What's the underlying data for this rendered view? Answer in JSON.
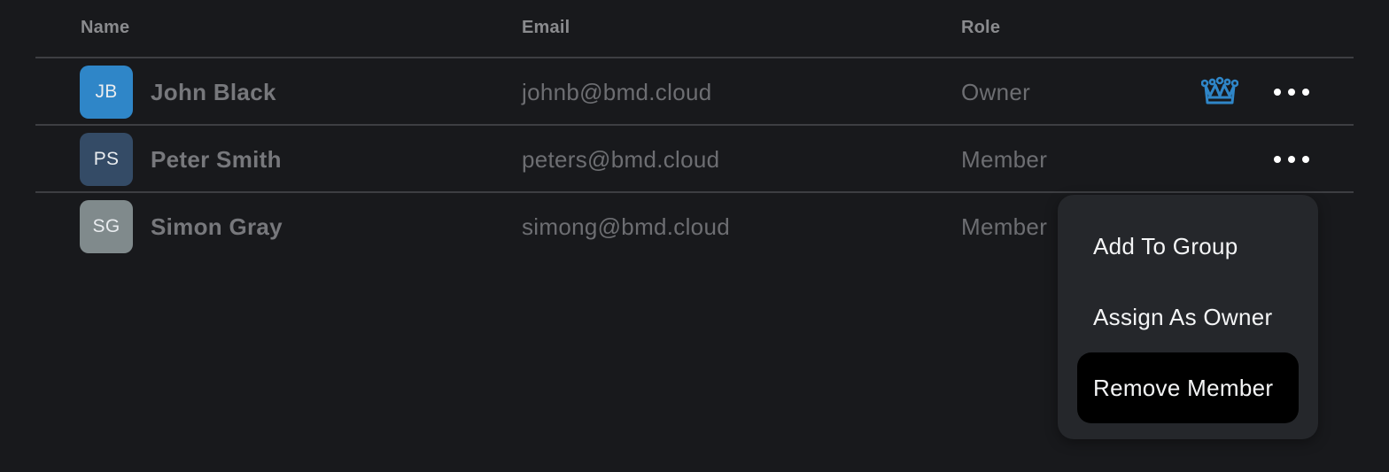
{
  "columns": {
    "name": "Name",
    "email": "Email",
    "role": "Role"
  },
  "members": [
    {
      "initials": "JB",
      "name": "John Black",
      "email": "johnb@bmd.cloud",
      "role": "Owner",
      "avatar_color": "#2f86c8",
      "is_owner": true,
      "owner_icon": "crown-icon"
    },
    {
      "initials": "PS",
      "name": "Peter Smith",
      "email": "peters@bmd.cloud",
      "role": "Member",
      "avatar_color": "#344b66",
      "is_owner": false
    },
    {
      "initials": "SG",
      "name": "Simon Gray",
      "email": "simong@bmd.cloud",
      "role": "Member",
      "avatar_color": "#808a8c",
      "is_owner": false
    }
  ],
  "context_menu": {
    "items": [
      {
        "label": "Add To Group"
      },
      {
        "label": "Assign As Owner"
      },
      {
        "label": "Remove Member",
        "highlighted": true
      }
    ]
  },
  "colors": {
    "background": "#18191c",
    "accent": "#2f86c8",
    "menu_background": "#25272b",
    "menu_highlight": "#000000"
  }
}
